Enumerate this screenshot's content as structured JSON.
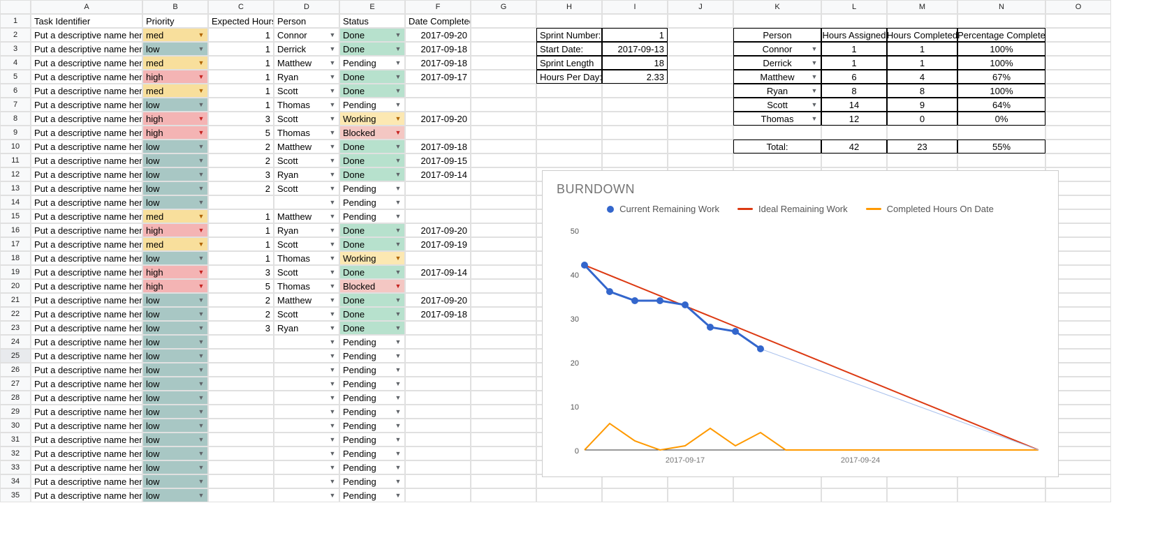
{
  "columns": [
    "",
    "A",
    "B",
    "C",
    "D",
    "E",
    "F",
    "G",
    "H",
    "I",
    "J",
    "K",
    "L",
    "M",
    "N",
    "O"
  ],
  "headers": {
    "A": "Task Identifier",
    "B": "Priority",
    "C": "Expected Hours",
    "D": "Person",
    "E": "Status",
    "F": "Date Completed"
  },
  "tasks": [
    {
      "r": 2,
      "task": "Put a descriptive name here",
      "prio": "med",
      "hrs": "1",
      "person": "Connor",
      "status": "Done",
      "date": "2017-09-20"
    },
    {
      "r": 3,
      "task": "Put a descriptive name here",
      "prio": "low",
      "hrs": "1",
      "person": "Derrick",
      "status": "Done",
      "date": "2017-09-18"
    },
    {
      "r": 4,
      "task": "Put a descriptive name here",
      "prio": "med",
      "hrs": "1",
      "person": "Matthew",
      "status": "Pending",
      "date": "2017-09-18"
    },
    {
      "r": 5,
      "task": "Put a descriptive name here",
      "prio": "high",
      "hrs": "1",
      "person": "Ryan",
      "status": "Done",
      "date": "2017-09-17"
    },
    {
      "r": 6,
      "task": "Put a descriptive name here",
      "prio": "med",
      "hrs": "1",
      "person": "Scott",
      "status": "Done",
      "date": ""
    },
    {
      "r": 7,
      "task": "Put a descriptive name here",
      "prio": "low",
      "hrs": "1",
      "person": "Thomas",
      "status": "Pending",
      "date": ""
    },
    {
      "r": 8,
      "task": "Put a descriptive name here",
      "prio": "high",
      "hrs": "3",
      "person": "Scott",
      "status": "Working",
      "date": "2017-09-20"
    },
    {
      "r": 9,
      "task": "Put a descriptive name here",
      "prio": "high",
      "hrs": "5",
      "person": "Thomas",
      "status": "Blocked",
      "date": ""
    },
    {
      "r": 10,
      "task": "Put a descriptive name here",
      "prio": "low",
      "hrs": "2",
      "person": "Matthew",
      "status": "Done",
      "date": "2017-09-18"
    },
    {
      "r": 11,
      "task": "Put a descriptive name here",
      "prio": "low",
      "hrs": "2",
      "person": "Scott",
      "status": "Done",
      "date": "2017-09-15"
    },
    {
      "r": 12,
      "task": "Put a descriptive name here",
      "prio": "low",
      "hrs": "3",
      "person": "Ryan",
      "status": "Done",
      "date": "2017-09-14"
    },
    {
      "r": 13,
      "task": "Put a descriptive name here",
      "prio": "low",
      "hrs": "2",
      "person": "Scott",
      "status": "Pending",
      "date": ""
    },
    {
      "r": 14,
      "task": "Put a descriptive name here",
      "prio": "low",
      "hrs": "",
      "person": "",
      "status": "Pending",
      "date": ""
    },
    {
      "r": 15,
      "task": "Put a descriptive name here",
      "prio": "med",
      "hrs": "1",
      "person": "Matthew",
      "status": "Pending",
      "date": ""
    },
    {
      "r": 16,
      "task": "Put a descriptive name here",
      "prio": "high",
      "hrs": "1",
      "person": "Ryan",
      "status": "Done",
      "date": "2017-09-20"
    },
    {
      "r": 17,
      "task": "Put a descriptive name here",
      "prio": "med",
      "hrs": "1",
      "person": "Scott",
      "status": "Done",
      "date": "2017-09-19"
    },
    {
      "r": 18,
      "task": "Put a descriptive name here",
      "prio": "low",
      "hrs": "1",
      "person": "Thomas",
      "status": "Working",
      "date": ""
    },
    {
      "r": 19,
      "task": "Put a descriptive name here",
      "prio": "high",
      "hrs": "3",
      "person": "Scott",
      "status": "Done",
      "date": "2017-09-14"
    },
    {
      "r": 20,
      "task": "Put a descriptive name here",
      "prio": "high",
      "hrs": "5",
      "person": "Thomas",
      "status": "Blocked",
      "date": ""
    },
    {
      "r": 21,
      "task": "Put a descriptive name here",
      "prio": "low",
      "hrs": "2",
      "person": "Matthew",
      "status": "Done",
      "date": "2017-09-20"
    },
    {
      "r": 22,
      "task": "Put a descriptive name here",
      "prio": "low",
      "hrs": "2",
      "person": "Scott",
      "status": "Done",
      "date": "2017-09-18"
    },
    {
      "r": 23,
      "task": "Put a descriptive name here",
      "prio": "low",
      "hrs": "3",
      "person": "Ryan",
      "status": "Done",
      "date": ""
    },
    {
      "r": 24,
      "task": "Put a descriptive name here",
      "prio": "low",
      "hrs": "",
      "person": "",
      "status": "Pending",
      "date": ""
    },
    {
      "r": 25,
      "task": "Put a descriptive name here",
      "prio": "low",
      "hrs": "",
      "person": "",
      "status": "Pending",
      "date": ""
    },
    {
      "r": 26,
      "task": "Put a descriptive name here",
      "prio": "low",
      "hrs": "",
      "person": "",
      "status": "Pending",
      "date": ""
    },
    {
      "r": 27,
      "task": "Put a descriptive name here",
      "prio": "low",
      "hrs": "",
      "person": "",
      "status": "Pending",
      "date": ""
    },
    {
      "r": 28,
      "task": "Put a descriptive name here",
      "prio": "low",
      "hrs": "",
      "person": "",
      "status": "Pending",
      "date": ""
    },
    {
      "r": 29,
      "task": "Put a descriptive name here",
      "prio": "low",
      "hrs": "",
      "person": "",
      "status": "Pending",
      "date": ""
    },
    {
      "r": 30,
      "task": "Put a descriptive name here",
      "prio": "low",
      "hrs": "",
      "person": "",
      "status": "Pending",
      "date": ""
    },
    {
      "r": 31,
      "task": "Put a descriptive name here",
      "prio": "low",
      "hrs": "",
      "person": "",
      "status": "Pending",
      "date": ""
    },
    {
      "r": 32,
      "task": "Put a descriptive name here",
      "prio": "low",
      "hrs": "",
      "person": "",
      "status": "Pending",
      "date": ""
    },
    {
      "r": 33,
      "task": "Put a descriptive name here",
      "prio": "low",
      "hrs": "",
      "person": "",
      "status": "Pending",
      "date": ""
    },
    {
      "r": 34,
      "task": "Put a descriptive name here",
      "prio": "low",
      "hrs": "",
      "person": "",
      "status": "Pending",
      "date": ""
    },
    {
      "r": 35,
      "task": "Put a descriptive name here",
      "prio": "low",
      "hrs": "",
      "person": "",
      "status": "Pending",
      "date": ""
    }
  ],
  "sprint": [
    {
      "label": "Sprint Number:",
      "value": "1"
    },
    {
      "label": "Start Date:",
      "value": "2017-09-13"
    },
    {
      "label": "Sprint Length",
      "value": "18"
    },
    {
      "label": "Hours Per Day:",
      "value": "2.33"
    }
  ],
  "summary": {
    "headers": [
      "Person",
      "Hours Assigned",
      "Hours Completed",
      "Percentage Complete"
    ],
    "rows": [
      {
        "person": "Connor",
        "ha": "1",
        "hc": "1",
        "pc": "100%"
      },
      {
        "person": "Derrick",
        "ha": "1",
        "hc": "1",
        "pc": "100%"
      },
      {
        "person": "Matthew",
        "ha": "6",
        "hc": "4",
        "pc": "67%"
      },
      {
        "person": "Ryan",
        "ha": "8",
        "hc": "8",
        "pc": "100%"
      },
      {
        "person": "Scott",
        "ha": "14",
        "hc": "9",
        "pc": "64%"
      },
      {
        "person": "Thomas",
        "ha": "12",
        "hc": "0",
        "pc": "0%"
      }
    ],
    "total": {
      "label": "Total:",
      "ha": "42",
      "hc": "23",
      "pc": "55%"
    }
  },
  "chart": {
    "title": "BURNDOWN",
    "legend": [
      "Current Remaining Work",
      "Ideal Remaining Work",
      "Completed Hours On Date"
    ],
    "xticks": [
      "2017-09-17",
      "2017-09-24"
    ]
  },
  "chart_data": {
    "type": "line",
    "title": "BURNDOWN",
    "ylim": [
      0,
      50
    ],
    "xticks": [
      "2017-09-17",
      "2017-09-24"
    ],
    "series": [
      {
        "name": "Current Remaining Work",
        "type": "scatter-line",
        "color": "#3366cc",
        "x": [
          "2017-09-13",
          "2017-09-14",
          "2017-09-15",
          "2017-09-16",
          "2017-09-17",
          "2017-09-18",
          "2017-09-19",
          "2017-09-20"
        ],
        "y": [
          42,
          36,
          34,
          34,
          33,
          28,
          27,
          23
        ]
      },
      {
        "name": "Ideal Remaining Work",
        "type": "line",
        "color": "#dc3912",
        "x": [
          "2017-09-13",
          "2017-10-01"
        ],
        "y": [
          42,
          0
        ]
      },
      {
        "name": "Completed Hours On Date",
        "type": "line",
        "color": "#ff9900",
        "x": [
          "2017-09-13",
          "2017-09-14",
          "2017-09-15",
          "2017-09-16",
          "2017-09-17",
          "2017-09-18",
          "2017-09-19",
          "2017-09-20",
          "2017-09-21",
          "2017-10-01"
        ],
        "y": [
          0,
          6,
          2,
          0,
          1,
          5,
          1,
          4,
          0,
          0
        ]
      }
    ]
  }
}
